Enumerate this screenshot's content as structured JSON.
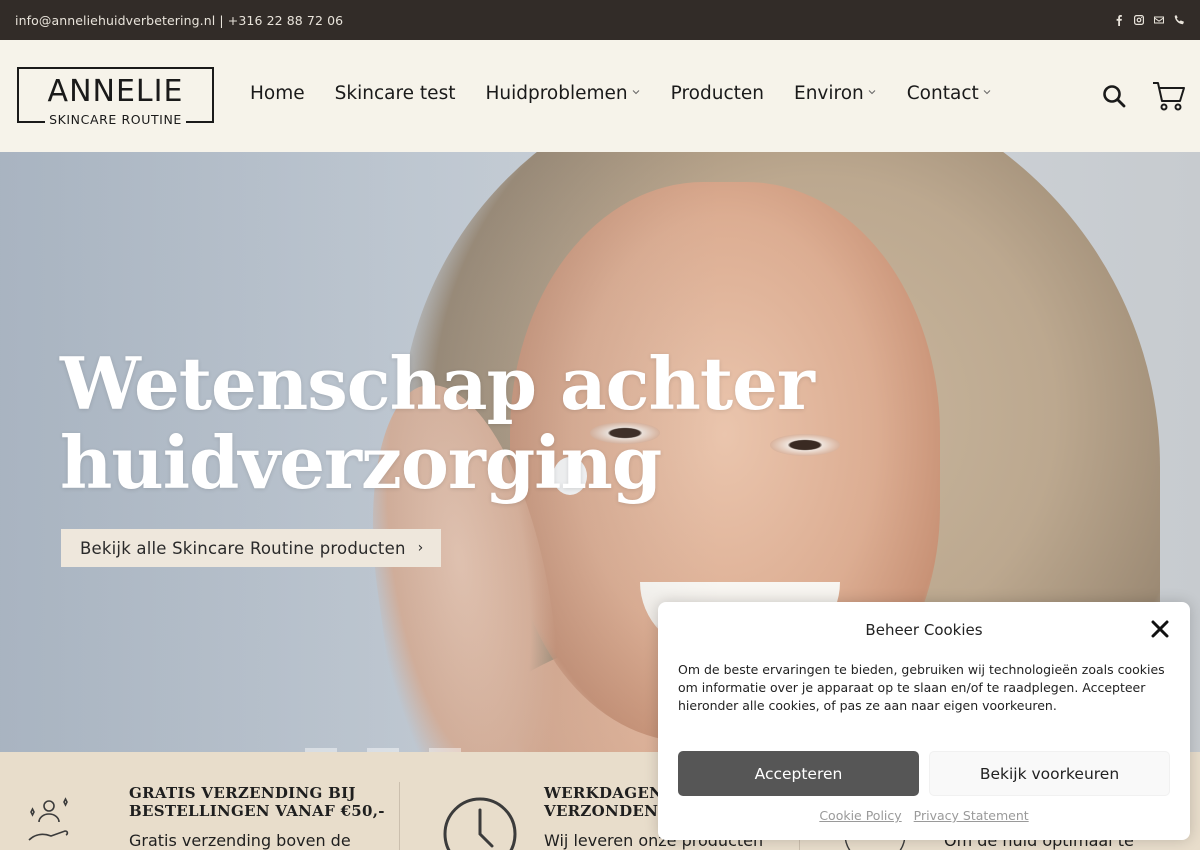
{
  "topbar": {
    "contact": "info@anneliehuidverbetering.nl | +316 22 88 72 06",
    "icons": [
      "facebook-icon",
      "instagram-icon",
      "mail-icon",
      "phone-icon"
    ]
  },
  "header": {
    "logo": {
      "brand": "ANNELIE",
      "tagline": "SKINCARE ROUTINE"
    },
    "nav": [
      {
        "label": "Home",
        "has_dropdown": false
      },
      {
        "label": "Skincare test",
        "has_dropdown": false
      },
      {
        "label": "Huidproblemen",
        "has_dropdown": true
      },
      {
        "label": "Producten",
        "has_dropdown": false
      },
      {
        "label": "Environ",
        "has_dropdown": true
      },
      {
        "label": "Contact",
        "has_dropdown": true
      }
    ],
    "icons": [
      "search-icon",
      "cart-icon"
    ]
  },
  "hero": {
    "title_line1": "Wetenschap achter",
    "title_line2": "huidverzorging",
    "cta_label": "Bekijk alle Skincare Routine producten",
    "cta_arrow": "›"
  },
  "features": [
    {
      "title_line1": "GRATIS VERZENDING BIJ",
      "title_line2": "BESTELLINGEN VANAF €50,-",
      "text": "Gratis verzending boven de",
      "icon": "hand-with-sparkles-icon"
    },
    {
      "title_line1": "WERKDAGEN",
      "title_line2": "VERZONDEN",
      "text": "Wij leveren onze producten",
      "icon": "clock-icon"
    },
    {
      "title_line1": "",
      "title_line2": "",
      "text": "Om de huid optimaal te",
      "icon": "skin-icon"
    }
  ],
  "cookie": {
    "title": "Beheer Cookies",
    "body": "Om de beste ervaringen te bieden, gebruiken wij technologieën zoals cookies om informatie over je apparaat op te slaan en/of te raadplegen. Accepteer hieronder alle cookies, of pas ze aan naar eigen voorkeuren.",
    "accept_label": "Accepteren",
    "preferences_label": "Bekijk voorkeuren",
    "links": [
      "Cookie Policy",
      "Privacy Statement"
    ]
  },
  "colors": {
    "topbar_bg": "#322c28",
    "header_bg": "#f6f3ea",
    "features_bg": "#e8ddcb",
    "cta_bg": "#eee7dc",
    "accept_bg": "#565656"
  }
}
